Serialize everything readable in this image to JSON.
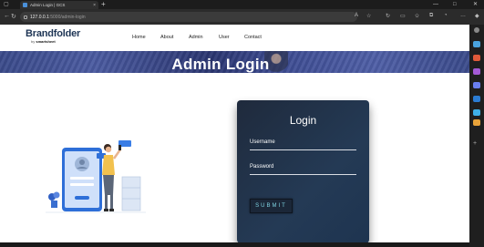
{
  "browser": {
    "tab_title": "Admin Login | GCS",
    "tab_close": "×",
    "new_tab": "+",
    "url_host": "127.0.0.1",
    "url_path": ":5000/admin-login",
    "window_minimize": "—",
    "window_maximize": "□",
    "window_close": "✕"
  },
  "site": {
    "logo_main": "Brandfolder",
    "logo_by": "by",
    "logo_company": "smartsheet",
    "nav": [
      "Home",
      "About",
      "Admin",
      "User",
      "Contact"
    ]
  },
  "banner": {
    "title": "Admin Login"
  },
  "login": {
    "title": "Login",
    "username_label": "Username",
    "password_label": "Password",
    "submit_label": "SUBMIT"
  },
  "colors": {
    "banner": "#3a4a8a",
    "card": "#1f2a3c",
    "submit_text": "#7fd4e3",
    "brand": "#1e3555"
  },
  "icons": {
    "sidebar": [
      "search-icon",
      "bag-icon",
      "tools-icon",
      "person-icon",
      "copilot-icon",
      "outlook-icon",
      "send-icon",
      "office-icon",
      "add-icon"
    ]
  }
}
